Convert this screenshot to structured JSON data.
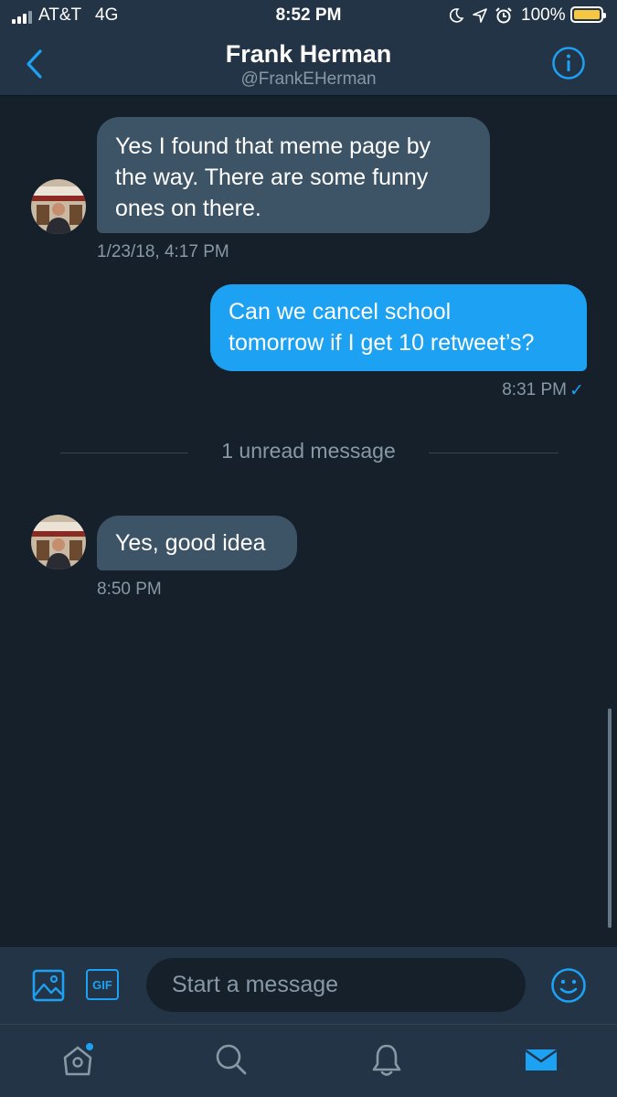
{
  "status_bar": {
    "carrier": "AT&T",
    "network": "4G",
    "time": "8:52 PM",
    "battery": "100%"
  },
  "header": {
    "title": "Frank Herman",
    "handle": "@FrankEHerman"
  },
  "messages": [
    {
      "direction": "incoming",
      "lines": [
        "Yes I found that meme page by",
        "the way.  There are some funny",
        "ones on there."
      ],
      "timestamp": "1/23/18, 4:17 PM"
    },
    {
      "direction": "outgoing",
      "lines": [
        "Can we cancel school",
        "tomorrow if I get 10 retweet’s?"
      ],
      "timestamp": "8:31 PM",
      "status": "✓"
    },
    {
      "direction": "incoming",
      "lines": [
        "Yes, good idea"
      ],
      "timestamp": "8:50 PM"
    }
  ],
  "unread_divider": "1 unread message",
  "composer": {
    "placeholder": "Start a message",
    "gif_label": "GIF",
    "icons": [
      "image-icon",
      "gif-icon",
      "emoji-icon"
    ]
  },
  "tab_bar": {
    "items": [
      "home",
      "search",
      "notifications",
      "messages"
    ],
    "active": "messages",
    "home_has_badge_dot": true
  },
  "colors": {
    "background": "#15202b",
    "bar": "#243447",
    "accent": "#1da1f2",
    "incoming_bubble": "#3d5466",
    "secondary_text": "#8899a6",
    "battery": "#f5c742"
  }
}
